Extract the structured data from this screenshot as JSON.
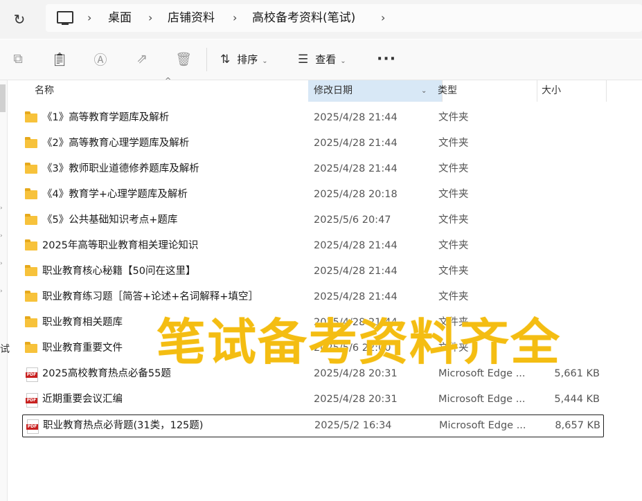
{
  "address_bar": {
    "breadcrumbs": [
      "桌面",
      "店铺资料",
      "高校备考资料(笔试)"
    ]
  },
  "toolbar": {
    "icons": [
      "copy-icon",
      "paste-icon",
      "rename-icon",
      "share-icon",
      "delete-icon"
    ],
    "sort_label": "排序",
    "view_label": "查看",
    "more_label": "···"
  },
  "columns": {
    "name": "名称",
    "date": "修改日期",
    "type": "类型",
    "size": "大小"
  },
  "files": [
    {
      "name": "《1》高等教育学题库及解析",
      "date": "2025/4/28 21:44",
      "type": "文件夹",
      "size": "",
      "kind": "folder"
    },
    {
      "name": "《2》高等教育心理学题库及解析",
      "date": "2025/4/28 21:44",
      "type": "文件夹",
      "size": "",
      "kind": "folder"
    },
    {
      "name": "《3》教师职业道德修养题库及解析",
      "date": "2025/4/28 21:44",
      "type": "文件夹",
      "size": "",
      "kind": "folder"
    },
    {
      "name": "《4》教育学+心理学题库及解析",
      "date": "2025/4/28 20:18",
      "type": "文件夹",
      "size": "",
      "kind": "folder"
    },
    {
      "name": "《5》公共基础知识考点+题库",
      "date": "2025/5/6 20:47",
      "type": "文件夹",
      "size": "",
      "kind": "folder"
    },
    {
      "name": "2025年高等职业教育相关理论知识",
      "date": "2025/4/28 21:44",
      "type": "文件夹",
      "size": "",
      "kind": "folder"
    },
    {
      "name": "职业教育核心秘籍【50问在这里】",
      "date": "2025/4/28 21:44",
      "type": "文件夹",
      "size": "",
      "kind": "folder"
    },
    {
      "name": "职业教育练习题［简答+论述+名词解释+填空］",
      "date": "2025/4/28 21:44",
      "type": "文件夹",
      "size": "",
      "kind": "folder"
    },
    {
      "name": "职业教育相关题库",
      "date": "2025/4/28 21:44",
      "type": "文件夹",
      "size": "",
      "kind": "folder"
    },
    {
      "name": "职业教育重要文件",
      "date": "2025/5/6 22:00",
      "type": "文件夹",
      "size": "",
      "kind": "folder"
    },
    {
      "name": "2025高校教育热点必备55题",
      "date": "2025/4/28 20:31",
      "type": "Microsoft Edge ...",
      "size": "5,661 KB",
      "kind": "pdf"
    },
    {
      "name": "近期重要会议汇编",
      "date": "2025/4/28 20:31",
      "type": "Microsoft Edge ...",
      "size": "5,444 KB",
      "kind": "pdf"
    },
    {
      "name": "职业教育热点必背题(31类，125题)",
      "date": "2025/5/2 16:34",
      "type": "Microsoft Edge ...",
      "size": "8,657 KB",
      "kind": "pdf",
      "selected": true
    }
  ],
  "pdf_badge": "PDF",
  "nav_partial_label": "试",
  "overlay_text": "笔试备考资料齐全",
  "colors": {
    "overlay": "#f4bd12",
    "folder": "#f7c23b",
    "sorted_column": "#d8e8f6",
    "pdf_badge": "#c8201f"
  }
}
